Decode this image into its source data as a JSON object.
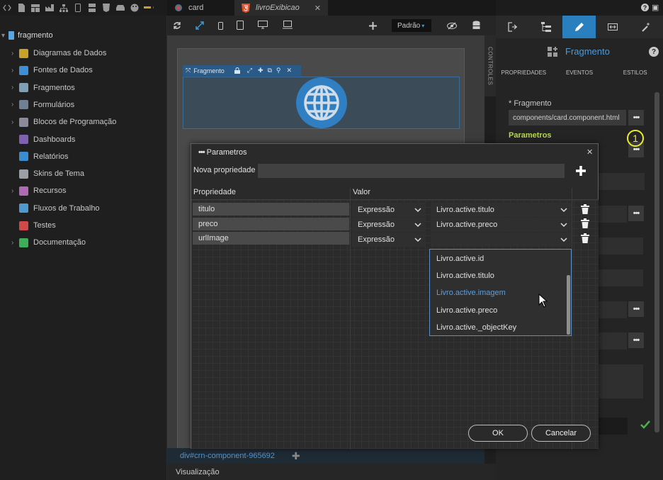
{
  "tree": {
    "root": "fragmento",
    "items": [
      {
        "label": "Diagramas de Dados",
        "expandable": true,
        "color": "#c9a227"
      },
      {
        "label": "Fontes de Dados",
        "expandable": true,
        "color": "#3c8fd6"
      },
      {
        "label": "Fragmentos",
        "expandable": true,
        "color": "#7ea0b6"
      },
      {
        "label": "Formulários",
        "expandable": true,
        "color": "#6f7f96"
      },
      {
        "label": "Blocos de Programação",
        "expandable": true,
        "color": "#8a8a9a"
      },
      {
        "label": "Dashboards",
        "expandable": false,
        "color": "#8060b0"
      },
      {
        "label": "Relatórios",
        "expandable": false,
        "color": "#3a8bd0"
      },
      {
        "label": "Skins de Tema",
        "expandable": false,
        "color": "#9aa0a6"
      },
      {
        "label": "Recursos",
        "expandable": true,
        "color": "#b06ab3"
      },
      {
        "label": "Fluxos de Trabalho",
        "expandable": false,
        "color": "#4e9ad0"
      },
      {
        "label": "Testes",
        "expandable": false,
        "color": "#d04848"
      },
      {
        "label": "Documentação",
        "expandable": true,
        "color": "#3fae5a"
      }
    ]
  },
  "tabs": [
    {
      "label": "card",
      "icon": "card-file-icon",
      "active": false
    },
    {
      "label": "livroExibicao",
      "icon": "html5-icon",
      "active": true
    }
  ],
  "toolbar": {
    "theme_select": "Padrão"
  },
  "canvas": {
    "fragment_label": "Fragmento",
    "breadcrumb": "div#crn-component-965692",
    "visualization": "Visualização"
  },
  "controls_tab": "CONTROLES",
  "properties": {
    "title": "Fragmento",
    "tabs": [
      "PROPRIEDADES",
      "EVENTOS",
      "ESTILOS"
    ],
    "fragment_label": "* Fragmento",
    "fragment_value": "components/card.component.html",
    "parametros_label": "Parametros",
    "badge": "1",
    "accent": "#2a80bf"
  },
  "modal": {
    "title": "Parametros",
    "new_property_label": "Nova propriedade",
    "col_property": "Propriedade",
    "col_value": "Valor",
    "rows": [
      {
        "name": "titulo",
        "type": "Expressão",
        "expr": "Livro.active.titulo"
      },
      {
        "name": "preco",
        "type": "Expressão",
        "expr": "Livro.active.preco"
      },
      {
        "name": "urlImage",
        "type": "Expressão",
        "expr": ""
      }
    ],
    "dropdown": [
      "Livro.active.id",
      "Livro.active.titulo",
      "Livro.active.imagem",
      "Livro.active.preco",
      "Livro.active._objectKey"
    ],
    "highlighted": "Livro.active.imagem",
    "ok": "OK",
    "cancel": "Cancelar"
  }
}
